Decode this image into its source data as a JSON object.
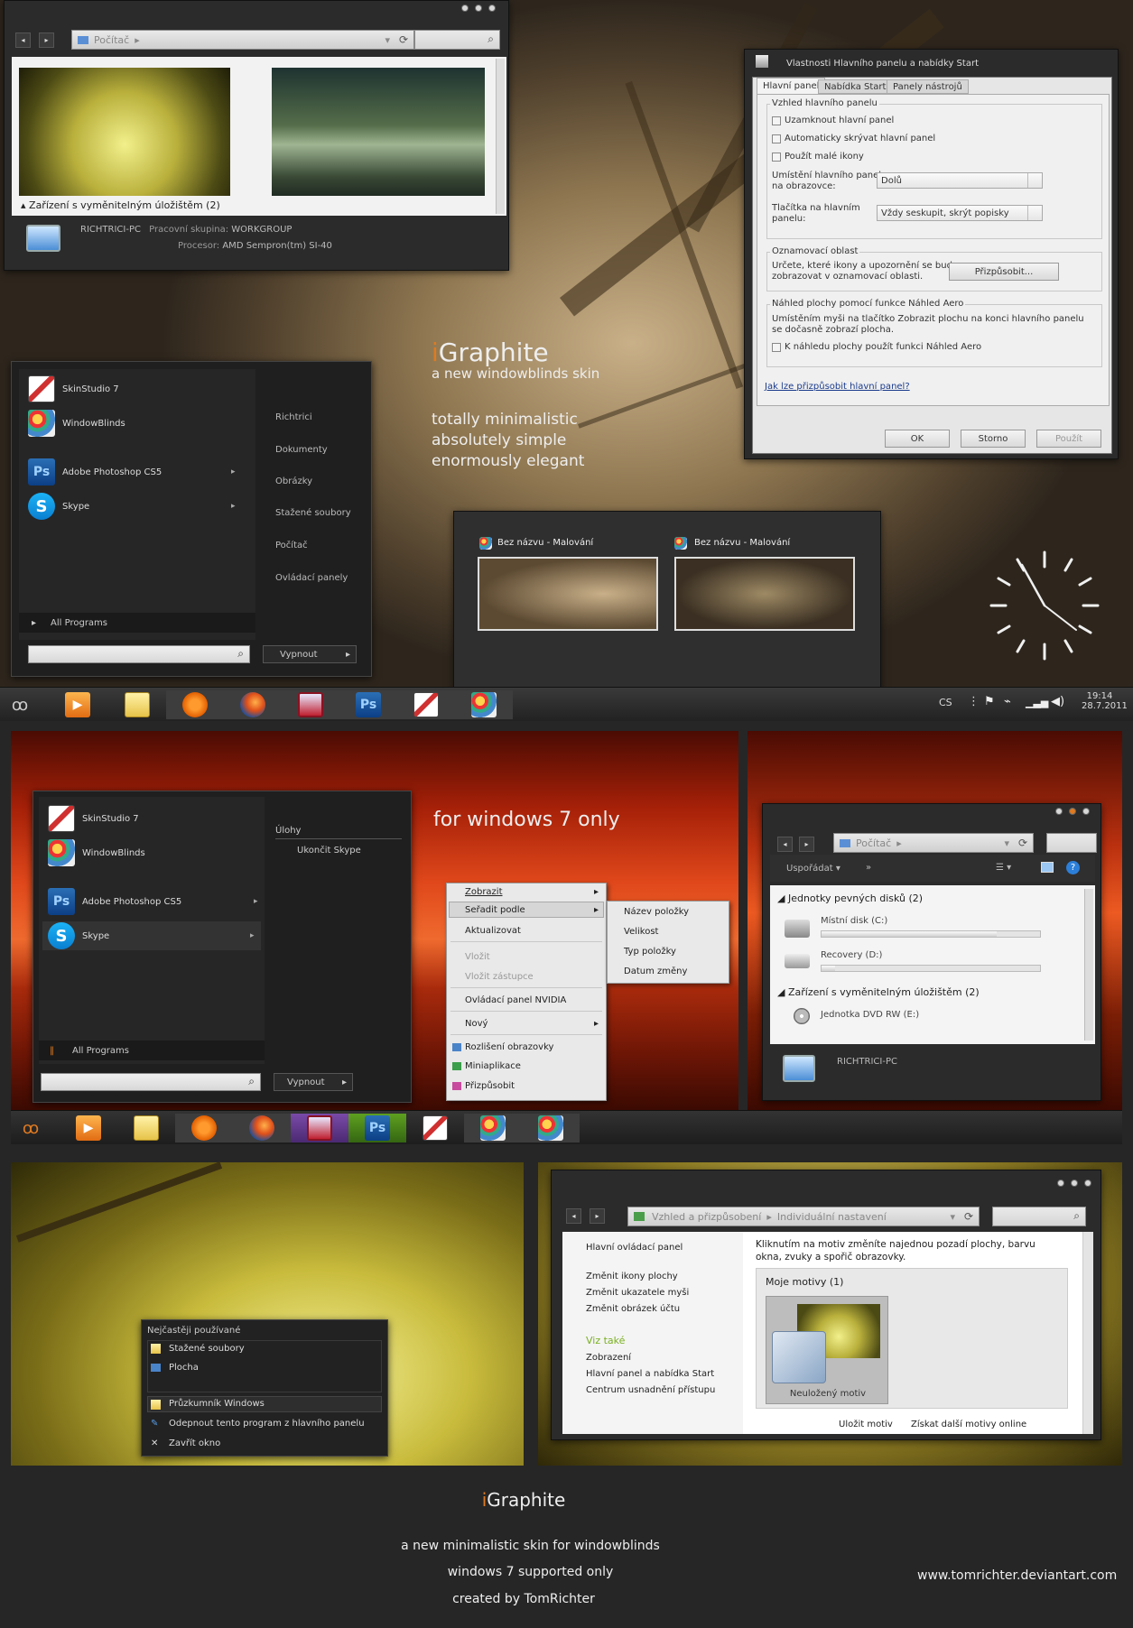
{
  "explorer1": {
    "address": "Počítač",
    "section": "Zařízení s vyměnitelným úložištěm (2)",
    "pc_name": "RICHTRICI-PC",
    "workgroup_label": "Pracovní skupina:",
    "workgroup": "WORKGROUP",
    "cpu_label": "Procesor:",
    "cpu": "AMD Sempron(tm) SI-40"
  },
  "startmenu1": {
    "pinned": [
      "SkinStudio 7",
      "WindowBlinds",
      "Adobe Photoshop CS5",
      "Skype"
    ],
    "right": [
      "Richtrici",
      "Dokumenty",
      "Obrázky",
      "Stažené soubory",
      "Počítač",
      "Ovládací panely"
    ],
    "all_programs": "All Programs",
    "shutdown": "Vypnout"
  },
  "tagline": {
    "title_accent": "i",
    "title_rest": "Graphite",
    "subtitle": "a new windowblinds skin",
    "line1": "totally minimalistic",
    "line2": "absolutely simple",
    "line3": "enormously elegant"
  },
  "dialog": {
    "title": "Vlastnosti Hlavního panelu a nabídky Start",
    "tabs": [
      "Hlavní panel",
      "Nabídka Start",
      "Panely nástrojů"
    ],
    "group1": "Vzhled hlavního panelu",
    "chk1": "Uzamknout hlavní panel",
    "chk2": "Automaticky skrývat hlavní panel",
    "chk3": "Použít malé ikony",
    "pos_label1": "Umístění hlavního panelu",
    "pos_label2": "na obrazovce:",
    "pos_value": "Dolů",
    "btns_label1": "Tlačítka na hlavním",
    "btns_label2": "panelu:",
    "btns_value": "Vždy seskupit, skrýt popisky",
    "group2": "Oznamovací oblast",
    "notif1": "Určete, které ikony a upozornění se budou",
    "notif2": "zobrazovat v oznamovací oblasti.",
    "customize": "Přizpůsobit...",
    "group3": "Náhled plochy pomocí funkce Náhled Aero",
    "aero1": "Umístěním myši na tlačítko Zobrazit plochu na konci hlavního panelu",
    "aero2": "se dočasně zobrazí plocha.",
    "aero_chk": "K náhledu plochy použít funkci Náhled Aero",
    "link": "Jak lze přizpůsobit hlavní panel?",
    "ok": "OK",
    "cancel": "Storno",
    "apply": "Použít"
  },
  "thumbs": {
    "title1": "Bez názvu - Malování",
    "title2": "Bez názvu - Malování"
  },
  "tray": {
    "lang": "CS",
    "time": "19:14",
    "date": "28.7.2011"
  },
  "sunset": {
    "headline": "for windows 7 only"
  },
  "startmenu2": {
    "pinned": [
      "SkinStudio 7",
      "WindowBlinds",
      "Adobe Photoshop CS5",
      "Skype"
    ],
    "right_header": "Úlohy",
    "right_item": "Ukončit Skype",
    "all_programs": "All Programs",
    "shutdown": "Vypnout"
  },
  "context": {
    "items": [
      "Zobrazit",
      "Seřadit podle",
      "Aktualizovat",
      "Vložit",
      "Vložit zástupce",
      "Ovládací panel NVIDIA",
      "Nový",
      "Rozlišení obrazovky",
      "Miniaplikace",
      "Přizpůsobit"
    ],
    "submenu": [
      "Název položky",
      "Velikost",
      "Typ položky",
      "Datum změny"
    ]
  },
  "explorer2": {
    "address": "Počítač",
    "organize": "Uspořádat",
    "more": "»",
    "section1": "Jednotky pevných disků (2)",
    "disk1": "Místní disk (C:)",
    "disk2": "Recovery (D:)",
    "section2": "Zařízení s vyměnitelným úložištěm (2)",
    "dvd": "Jednotka DVD RW (E:)",
    "pc_name": "RICHTRICI-PC",
    "disk1_fill": 0.8,
    "disk2_fill": 0.06
  },
  "jumplist": {
    "header": "Nejčastěji používané",
    "items": [
      "Stažené soubory",
      "Plocha"
    ],
    "actions": [
      "Průzkumník Windows",
      "Odepnout tento program z hlavního panelu",
      "Zavřít okno"
    ]
  },
  "personalize": {
    "crumb1": "Vzhled a přizpůsobení",
    "crumb2": "Individuální nastavení",
    "side": [
      "Hlavní ovládací panel",
      "Změnit ikony plochy",
      "Změnit ukazatele myši",
      "Změnit obrázek účtu"
    ],
    "see_also": "Viz také",
    "see_items": [
      "Zobrazení",
      "Hlavní panel a nabídka Start",
      "Centrum usnadnění přístupu"
    ],
    "intro1": "Kliknutím na motiv změníte najednou pozadí plochy, barvu",
    "intro2": "okna, zvuky a spořič obrazovky.",
    "my_themes": "Moje motivy (1)",
    "theme": "Neuložený motiv",
    "save": "Uložit motiv",
    "more": "Získat další motivy online"
  },
  "footer": {
    "title_accent": "i",
    "title_rest": "Graphite",
    "l1": "a new minimalistic skin for windowblinds",
    "l2": "windows 7 supported only",
    "l3": "created by TomRichter",
    "site": "www.tomrichter.deviantart.com"
  },
  "colors": {
    "accent": "#e07a20",
    "panel": "#2b2b2b",
    "background": "#262626"
  },
  "icons": [
    "play-icon",
    "folder-icon",
    "avast-icon",
    "firefox-icon",
    "floppy-icon",
    "photoshop-icon",
    "skinstudio-icon",
    "windowblinds-icon",
    "skype-icon",
    "flag-icon",
    "signal-icon",
    "volume-icon",
    "monitor-icon",
    "refresh-icon",
    "search-icon"
  ]
}
